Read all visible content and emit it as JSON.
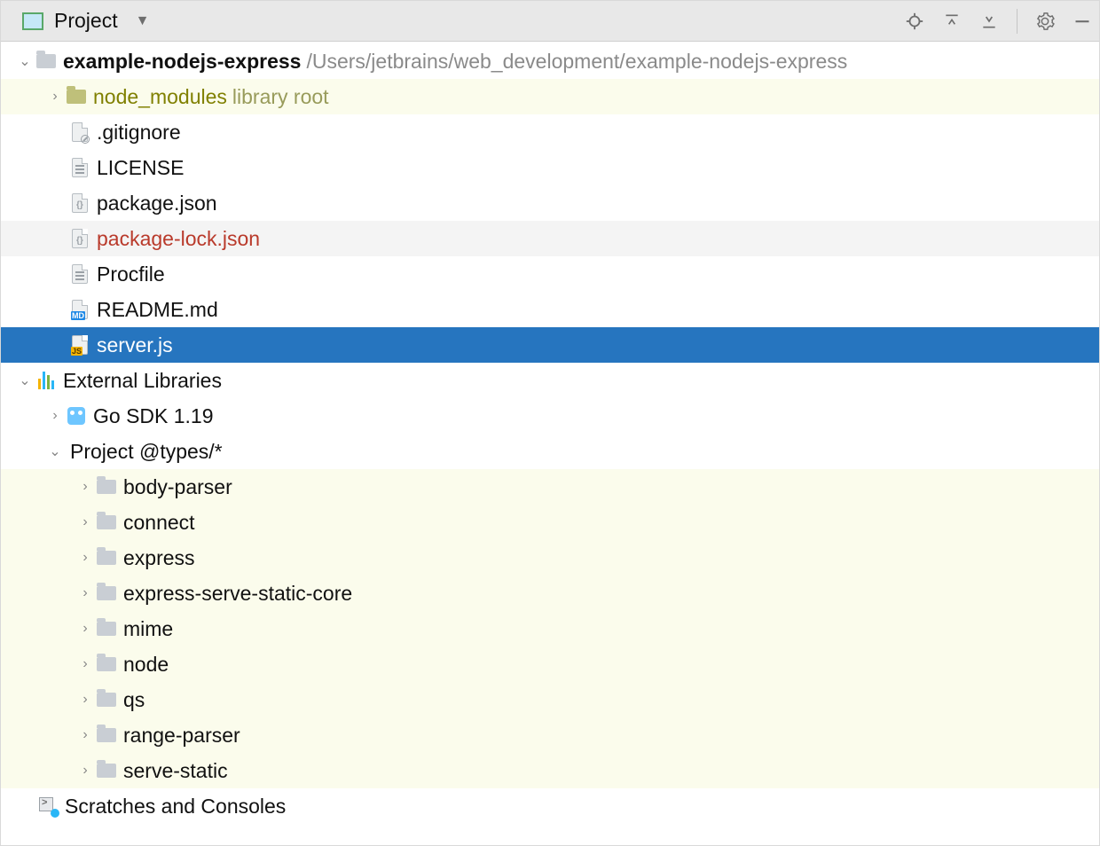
{
  "header": {
    "title": "Project"
  },
  "project": {
    "name": "example-nodejs-express",
    "path": "/Users/jetbrains/web_development/example-nodejs-express",
    "node_modules": {
      "label": "node_modules",
      "hint": "library root"
    },
    "files": [
      {
        "name": ".gitignore",
        "icon": "ignore"
      },
      {
        "name": "LICENSE",
        "icon": "text"
      },
      {
        "name": "package.json",
        "icon": "json"
      },
      {
        "name": "package-lock.json",
        "icon": "json",
        "color": "red"
      },
      {
        "name": "Procfile",
        "icon": "text"
      },
      {
        "name": "README.md",
        "icon": "md"
      },
      {
        "name": "server.js",
        "icon": "js",
        "selected": true
      }
    ]
  },
  "external_libraries": {
    "label": "External Libraries",
    "go_sdk": "Go SDK 1.19",
    "types_group": "Project @types/*",
    "types": [
      "body-parser",
      "connect",
      "express",
      "express-serve-static-core",
      "mime",
      "node",
      "qs",
      "range-parser",
      "serve-static"
    ]
  },
  "scratches": "Scratches and Consoles"
}
